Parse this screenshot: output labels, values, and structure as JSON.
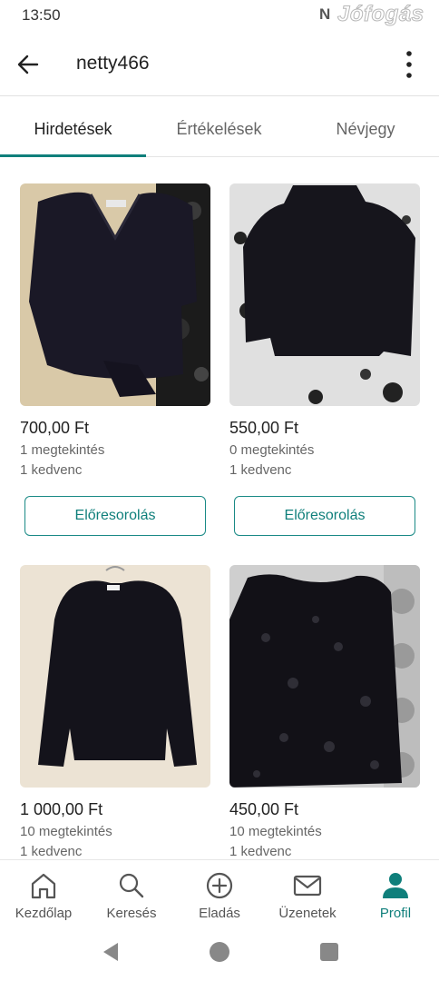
{
  "status": {
    "time": "13:50",
    "n_icon": "N",
    "watermark": "Jófogás"
  },
  "header": {
    "title": "netty466"
  },
  "tabs": [
    {
      "label": "Hirdetések",
      "active": true
    },
    {
      "label": "Értékelések",
      "active": false
    },
    {
      "label": "Névjegy",
      "active": false
    }
  ],
  "listings": [
    {
      "price": "700,00 Ft",
      "views": "1 megtekintés",
      "favorites": "1 kedvenc",
      "promote_label": "Előresorolás",
      "image": "black-v-neck-sweater"
    },
    {
      "price": "550,00 Ft",
      "views": "0 megtekintés",
      "favorites": "1 kedvenc",
      "promote_label": "Előresorolás",
      "image": "black-turtleneck-sweater"
    },
    {
      "price": "1 000,00 Ft",
      "views": "10 megtekintés",
      "favorites": "1 kedvenc",
      "image": "black-cardigan"
    },
    {
      "price": "450,00 Ft",
      "views": "10 megtekintés",
      "favorites": "1 kedvenc",
      "image": "black-lace-top"
    }
  ],
  "bottom_nav": [
    {
      "label": "Kezdőlap",
      "icon": "home-icon",
      "active": false
    },
    {
      "label": "Keresés",
      "icon": "search-icon",
      "active": false
    },
    {
      "label": "Eladás",
      "icon": "add-circle-icon",
      "active": false
    },
    {
      "label": "Üzenetek",
      "icon": "mail-icon",
      "active": false
    },
    {
      "label": "Profil",
      "icon": "person-icon",
      "active": true
    }
  ],
  "colors": {
    "accent": "#0f7f7b",
    "text": "#222222",
    "muted": "#666666"
  }
}
